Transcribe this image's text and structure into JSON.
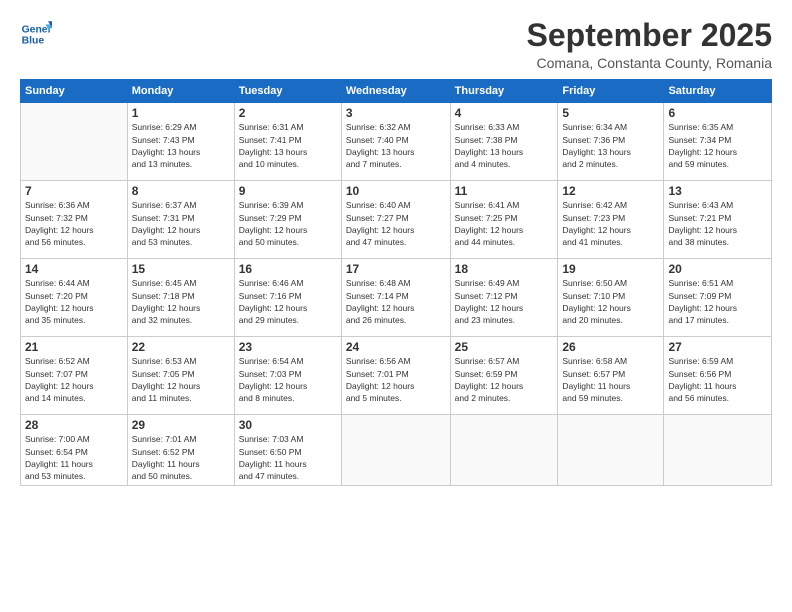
{
  "header": {
    "logo_line1": "General",
    "logo_line2": "Blue",
    "month": "September 2025",
    "location": "Comana, Constanta County, Romania"
  },
  "weekdays": [
    "Sunday",
    "Monday",
    "Tuesday",
    "Wednesday",
    "Thursday",
    "Friday",
    "Saturday"
  ],
  "weeks": [
    [
      {
        "day": "",
        "info": ""
      },
      {
        "day": "1",
        "info": "Sunrise: 6:29 AM\nSunset: 7:43 PM\nDaylight: 13 hours\nand 13 minutes."
      },
      {
        "day": "2",
        "info": "Sunrise: 6:31 AM\nSunset: 7:41 PM\nDaylight: 13 hours\nand 10 minutes."
      },
      {
        "day": "3",
        "info": "Sunrise: 6:32 AM\nSunset: 7:40 PM\nDaylight: 13 hours\nand 7 minutes."
      },
      {
        "day": "4",
        "info": "Sunrise: 6:33 AM\nSunset: 7:38 PM\nDaylight: 13 hours\nand 4 minutes."
      },
      {
        "day": "5",
        "info": "Sunrise: 6:34 AM\nSunset: 7:36 PM\nDaylight: 13 hours\nand 2 minutes."
      },
      {
        "day": "6",
        "info": "Sunrise: 6:35 AM\nSunset: 7:34 PM\nDaylight: 12 hours\nand 59 minutes."
      }
    ],
    [
      {
        "day": "7",
        "info": "Sunrise: 6:36 AM\nSunset: 7:32 PM\nDaylight: 12 hours\nand 56 minutes."
      },
      {
        "day": "8",
        "info": "Sunrise: 6:37 AM\nSunset: 7:31 PM\nDaylight: 12 hours\nand 53 minutes."
      },
      {
        "day": "9",
        "info": "Sunrise: 6:39 AM\nSunset: 7:29 PM\nDaylight: 12 hours\nand 50 minutes."
      },
      {
        "day": "10",
        "info": "Sunrise: 6:40 AM\nSunset: 7:27 PM\nDaylight: 12 hours\nand 47 minutes."
      },
      {
        "day": "11",
        "info": "Sunrise: 6:41 AM\nSunset: 7:25 PM\nDaylight: 12 hours\nand 44 minutes."
      },
      {
        "day": "12",
        "info": "Sunrise: 6:42 AM\nSunset: 7:23 PM\nDaylight: 12 hours\nand 41 minutes."
      },
      {
        "day": "13",
        "info": "Sunrise: 6:43 AM\nSunset: 7:21 PM\nDaylight: 12 hours\nand 38 minutes."
      }
    ],
    [
      {
        "day": "14",
        "info": "Sunrise: 6:44 AM\nSunset: 7:20 PM\nDaylight: 12 hours\nand 35 minutes."
      },
      {
        "day": "15",
        "info": "Sunrise: 6:45 AM\nSunset: 7:18 PM\nDaylight: 12 hours\nand 32 minutes."
      },
      {
        "day": "16",
        "info": "Sunrise: 6:46 AM\nSunset: 7:16 PM\nDaylight: 12 hours\nand 29 minutes."
      },
      {
        "day": "17",
        "info": "Sunrise: 6:48 AM\nSunset: 7:14 PM\nDaylight: 12 hours\nand 26 minutes."
      },
      {
        "day": "18",
        "info": "Sunrise: 6:49 AM\nSunset: 7:12 PM\nDaylight: 12 hours\nand 23 minutes."
      },
      {
        "day": "19",
        "info": "Sunrise: 6:50 AM\nSunset: 7:10 PM\nDaylight: 12 hours\nand 20 minutes."
      },
      {
        "day": "20",
        "info": "Sunrise: 6:51 AM\nSunset: 7:09 PM\nDaylight: 12 hours\nand 17 minutes."
      }
    ],
    [
      {
        "day": "21",
        "info": "Sunrise: 6:52 AM\nSunset: 7:07 PM\nDaylight: 12 hours\nand 14 minutes."
      },
      {
        "day": "22",
        "info": "Sunrise: 6:53 AM\nSunset: 7:05 PM\nDaylight: 12 hours\nand 11 minutes."
      },
      {
        "day": "23",
        "info": "Sunrise: 6:54 AM\nSunset: 7:03 PM\nDaylight: 12 hours\nand 8 minutes."
      },
      {
        "day": "24",
        "info": "Sunrise: 6:56 AM\nSunset: 7:01 PM\nDaylight: 12 hours\nand 5 minutes."
      },
      {
        "day": "25",
        "info": "Sunrise: 6:57 AM\nSunset: 6:59 PM\nDaylight: 12 hours\nand 2 minutes."
      },
      {
        "day": "26",
        "info": "Sunrise: 6:58 AM\nSunset: 6:57 PM\nDaylight: 11 hours\nand 59 minutes."
      },
      {
        "day": "27",
        "info": "Sunrise: 6:59 AM\nSunset: 6:56 PM\nDaylight: 11 hours\nand 56 minutes."
      }
    ],
    [
      {
        "day": "28",
        "info": "Sunrise: 7:00 AM\nSunset: 6:54 PM\nDaylight: 11 hours\nand 53 minutes."
      },
      {
        "day": "29",
        "info": "Sunrise: 7:01 AM\nSunset: 6:52 PM\nDaylight: 11 hours\nand 50 minutes."
      },
      {
        "day": "30",
        "info": "Sunrise: 7:03 AM\nSunset: 6:50 PM\nDaylight: 11 hours\nand 47 minutes."
      },
      {
        "day": "",
        "info": ""
      },
      {
        "day": "",
        "info": ""
      },
      {
        "day": "",
        "info": ""
      },
      {
        "day": "",
        "info": ""
      }
    ]
  ]
}
